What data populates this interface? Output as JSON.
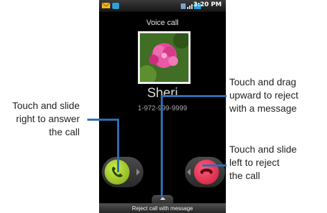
{
  "status_bar": {
    "time": "3:20 PM",
    "icons": [
      "mail-icon",
      "usb-icon",
      "bluetooth-icon",
      "signal-icon",
      "battery-icon"
    ]
  },
  "call_screen": {
    "header": "Voice call",
    "caller_name": "Sheri",
    "caller_number": "1-972-999-9999",
    "answer_button_icon": "phone-answer-icon",
    "reject_button_icon": "phone-reject-icon",
    "reject_with_message_label": "Reject call with message"
  },
  "callouts": {
    "answer": [
      "Touch and slide",
      "right to answer",
      "the call"
    ],
    "reject_message": [
      "Touch and drag",
      "upward to reject",
      "with a message"
    ],
    "reject": [
      "Touch and slide",
      "left to reject",
      "the call"
    ]
  },
  "colors": {
    "callout_line": "#2a6fb3",
    "answer_button": "#a6d03a",
    "reject_button": "#e8334f"
  }
}
